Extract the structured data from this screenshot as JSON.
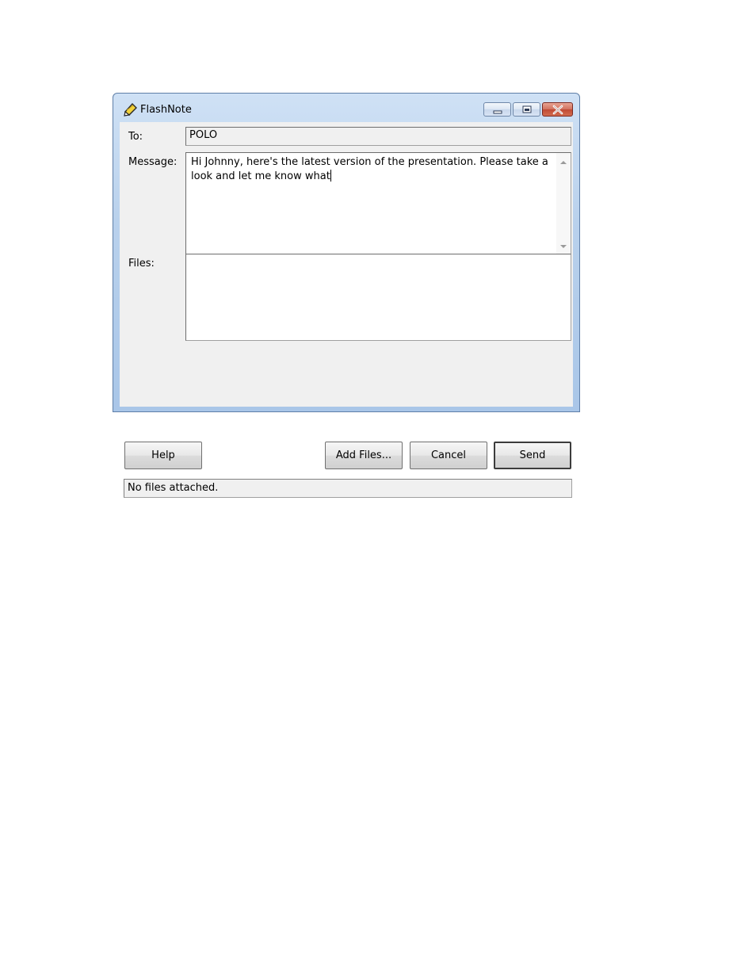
{
  "window": {
    "title": "FlashNote",
    "icon": "flashnote-pencil-icon"
  },
  "form": {
    "to_label": "To:",
    "to_value": "POLO",
    "message_label": "Message:",
    "message_value": "Hi Johnny, here's the latest version of the presentation. Please take a look and let me know what",
    "files_label": "Files:",
    "files_items": []
  },
  "buttons": {
    "help": "Help",
    "add_files": "Add Files...",
    "cancel": "Cancel",
    "send": "Send"
  },
  "status": {
    "text": "No files attached."
  },
  "colors": {
    "frame": "#b9d1ec",
    "client": "#f0f0f0",
    "close_button": "#c04a35"
  }
}
